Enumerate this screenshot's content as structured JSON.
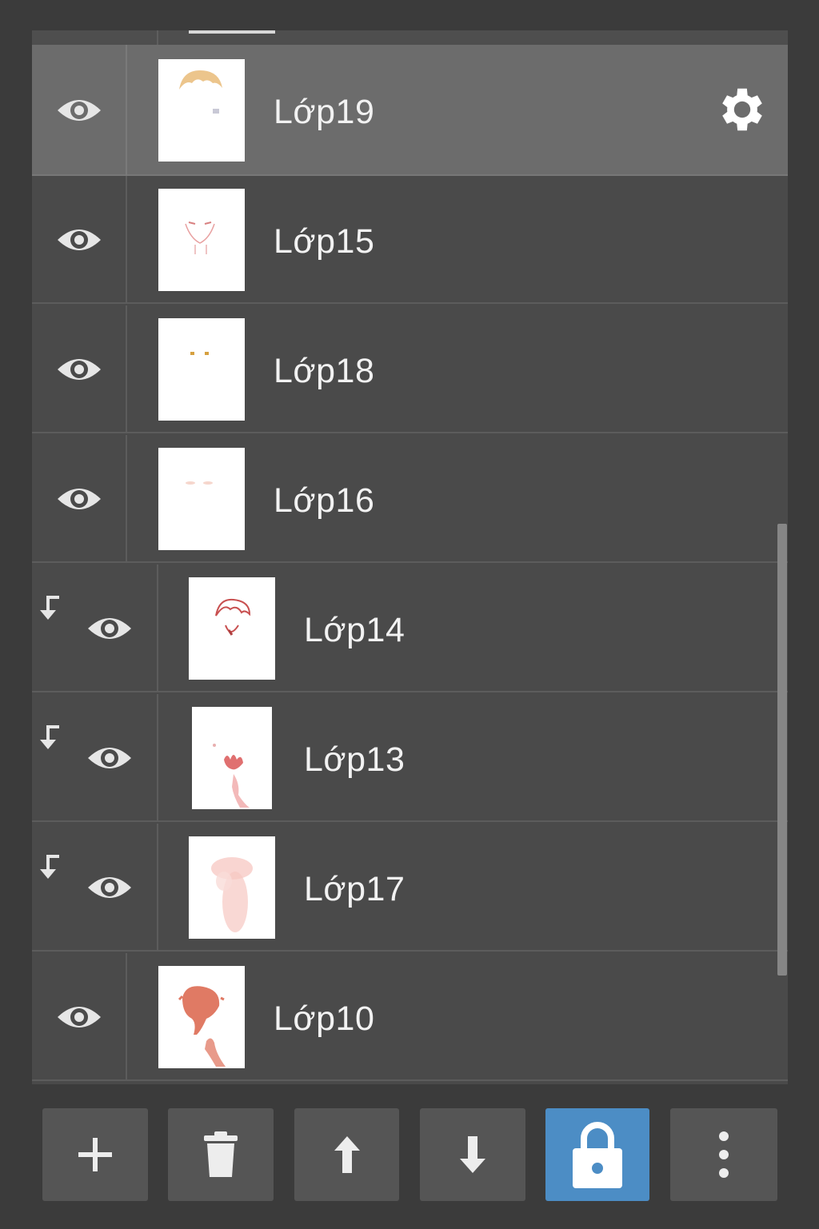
{
  "layers": [
    {
      "name": "Lớp19",
      "selected": true,
      "clipped": false
    },
    {
      "name": "Lớp15",
      "selected": false,
      "clipped": false
    },
    {
      "name": "Lớp18",
      "selected": false,
      "clipped": false
    },
    {
      "name": "Lớp16",
      "selected": false,
      "clipped": false
    },
    {
      "name": "Lớp14",
      "selected": false,
      "clipped": true
    },
    {
      "name": "Lớp13",
      "selected": false,
      "clipped": true
    },
    {
      "name": "Lớp17",
      "selected": false,
      "clipped": true
    },
    {
      "name": "Lớp10",
      "selected": false,
      "clipped": false
    }
  ],
  "toolbar": {
    "buttons": [
      {
        "icon": "plus-icon"
      },
      {
        "icon": "trash-icon"
      },
      {
        "icon": "arrow-up-icon"
      },
      {
        "icon": "arrow-down-icon"
      },
      {
        "icon": "lock-icon",
        "active": true
      },
      {
        "icon": "more-vertical-icon"
      }
    ]
  },
  "colors": {
    "background": "#3b3b3b",
    "row": "#4a4a4a",
    "selected_row": "#6c6c6c",
    "accent": "#4c8dc5",
    "text": "#f2f2f2"
  }
}
